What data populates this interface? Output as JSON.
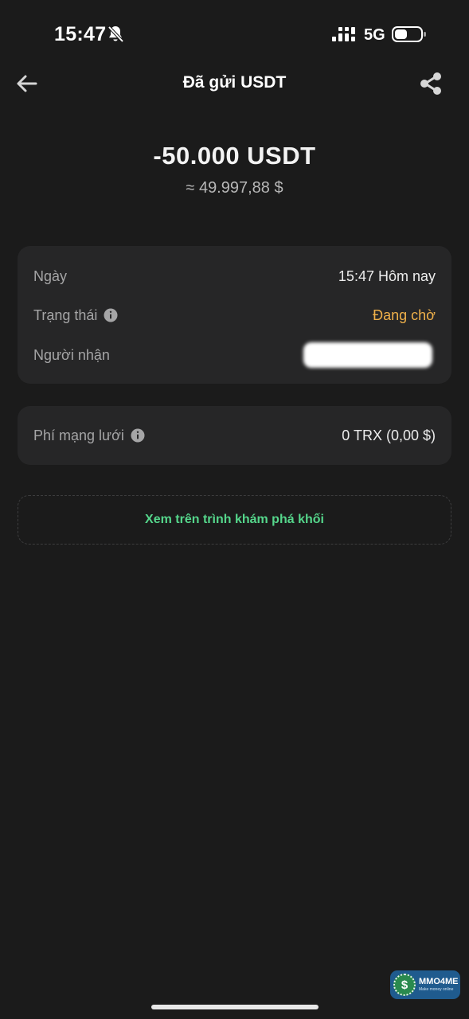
{
  "status_bar": {
    "time": "15:47",
    "network": "5G",
    "icons": [
      "bell-slash-icon",
      "signal-icon",
      "battery-icon"
    ]
  },
  "header": {
    "title": "Đã gửi USDT",
    "back_icon": "arrow-left-icon",
    "share_icon": "share-icon"
  },
  "transaction": {
    "amount": "-50.000 USDT",
    "fiat_value": "≈ 49.997,88 $"
  },
  "details": [
    {
      "label": "Ngày",
      "value": "15:47 Hôm nay",
      "has_info": false
    },
    {
      "label": "Trạng thái",
      "value": "Đang chờ",
      "has_info": true,
      "value_color": "#f0b14a"
    },
    {
      "label": "Người nhận",
      "value": "",
      "redacted": true
    }
  ],
  "fee": {
    "label": "Phí mạng lưới",
    "value": "0 TRX (0,00 $)",
    "has_info": true
  },
  "explorer": {
    "label": "Xem trên trình khám phá khối",
    "color": "#55d68b"
  },
  "watermark": {
    "name": "MMO4ME",
    "tagline": "Make money online"
  },
  "colors": {
    "background": "#1b1b1b",
    "card": "#262627",
    "pending": "#f0b14a",
    "link": "#55d68b"
  }
}
